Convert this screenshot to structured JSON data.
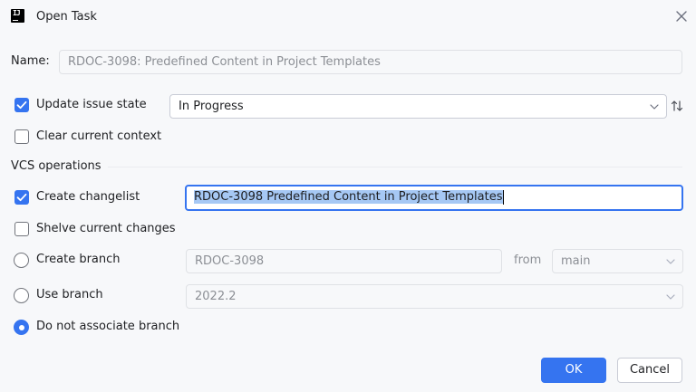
{
  "window": {
    "title": "Open Task"
  },
  "icons": {
    "app": "jetbrains-ide-icon",
    "close": "close-icon",
    "sort": "sort-arrows-icon",
    "dropdown": "chevron-down-icon",
    "check": "checkmark-icon"
  },
  "name_field": {
    "label": "Name:",
    "value": "RDOC-3098: Predefined Content in Project Templates"
  },
  "update_state": {
    "label": "Update issue state",
    "checked": true,
    "selected": "In Progress"
  },
  "clear_context": {
    "label": "Clear current context",
    "checked": false
  },
  "vcs": {
    "section_title": "VCS operations",
    "create_changelist": {
      "label": "Create changelist",
      "checked": true,
      "value": "RDOC-3098 Predefined Content in Project Templates"
    },
    "shelve": {
      "label": "Shelve current changes",
      "checked": false
    },
    "create_branch": {
      "label": "Create branch",
      "selected": false,
      "value": "RDOC-3098",
      "from_label": "from",
      "from_value": "main"
    },
    "use_branch": {
      "label": "Use branch",
      "selected": false,
      "value": "2022.2"
    },
    "no_branch": {
      "label": "Do not associate branch",
      "selected": true
    }
  },
  "buttons": {
    "ok": "OK",
    "cancel": "Cancel"
  },
  "colors": {
    "accent": "#3574f0",
    "background": "#f7f8fa",
    "selection": "#a6c8f4"
  }
}
